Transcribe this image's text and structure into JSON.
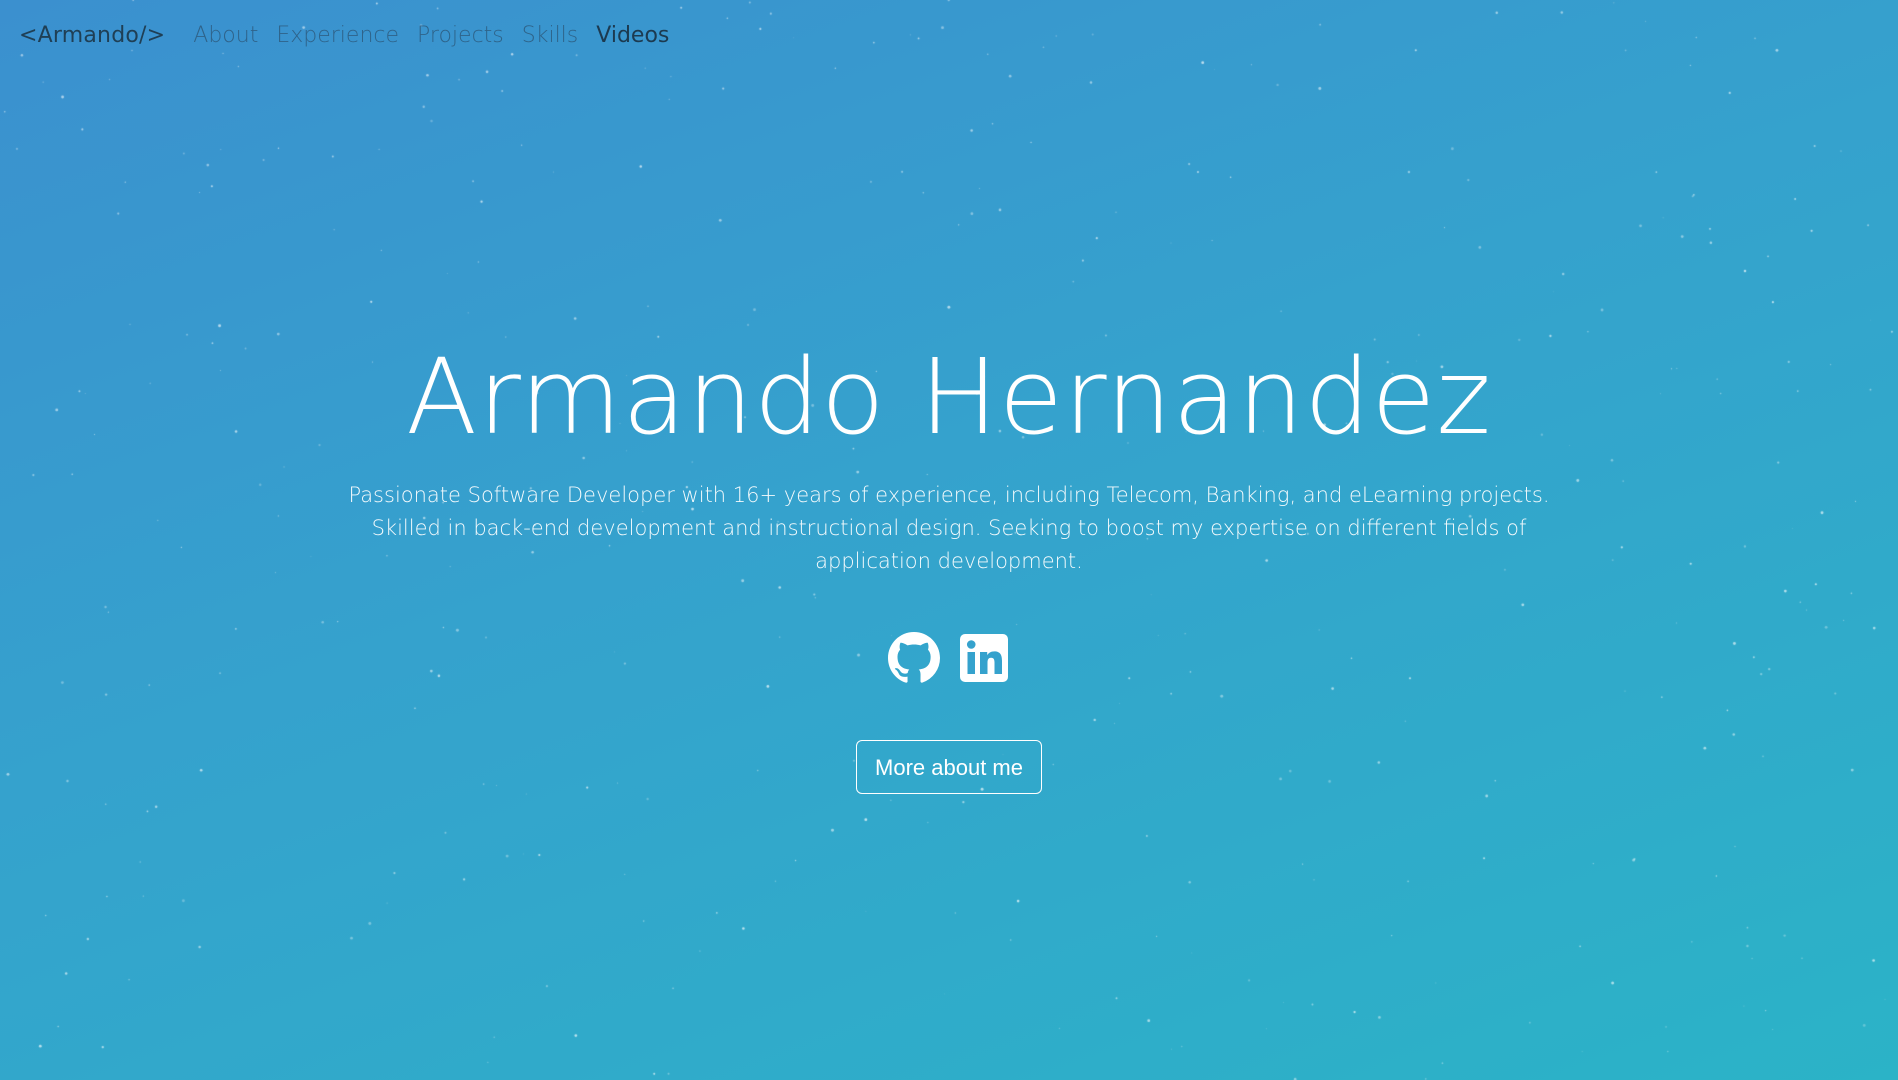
{
  "nav": {
    "brand": "<Armando/>",
    "links": [
      {
        "label": "About"
      },
      {
        "label": "Experience"
      },
      {
        "label": "Projects"
      },
      {
        "label": "Skills"
      },
      {
        "label": "Videos"
      }
    ],
    "active": "Videos"
  },
  "hero": {
    "name": "Armando Hernandez",
    "description": "Passionate Software Developer with 16+ years of experience, including Telecom, Banking, and eLearning projects. Skilled in back-end development and instructional design. Seeking to boost my expertise on different fields of application development.",
    "socials": [
      {
        "icon": "github-icon",
        "label": "GitHub"
      },
      {
        "icon": "linkedin-icon",
        "label": "LinkedIn"
      }
    ],
    "cta_label": "More about me"
  },
  "colors": {
    "gradient_start": "#3b90cf",
    "gradient_end": "#2bb3c7",
    "nav_text": "#1c3a50",
    "hero_text": "#ffffff"
  }
}
